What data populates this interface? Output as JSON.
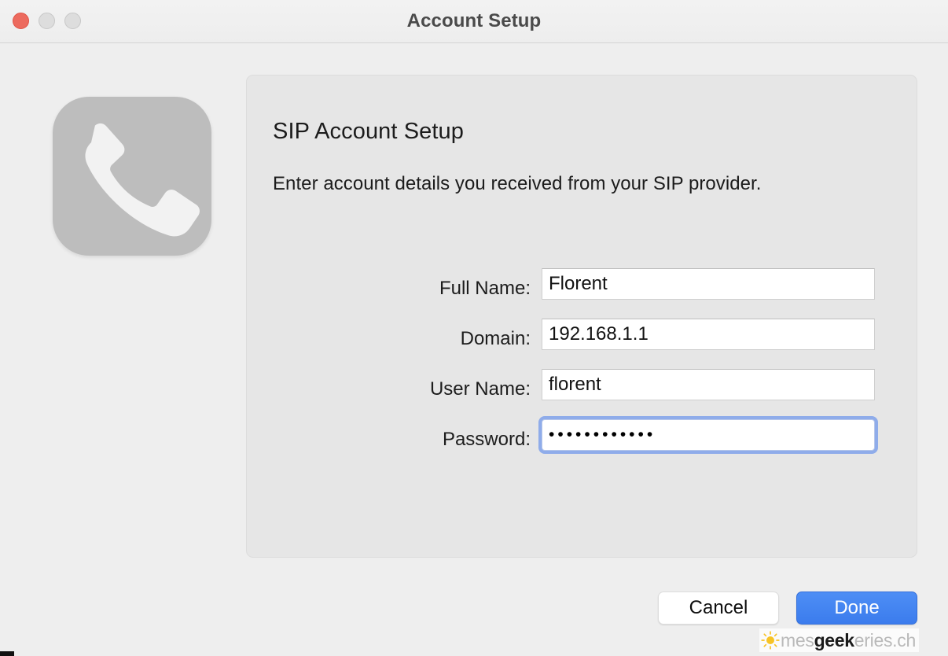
{
  "window": {
    "title": "Account Setup",
    "traffic_lights": [
      {
        "name": "close",
        "color": "#ec6a5e"
      },
      {
        "name": "minimize",
        "color": "#dddddd"
      },
      {
        "name": "zoom",
        "color": "#dddddd"
      }
    ]
  },
  "app_icon": {
    "name": "phone-handset-icon",
    "background_color": "#bdbdbd",
    "glyph_color": "#f2f2f2"
  },
  "panel": {
    "heading": "SIP Account Setup",
    "subtitle": "Enter account details you received from your SIP provider.",
    "background_color": "#e6e6e6"
  },
  "form": {
    "fields": [
      {
        "id": "full-name",
        "label": "Full Name:",
        "value": "Florent",
        "placeholder": "",
        "type": "text",
        "focused": false
      },
      {
        "id": "domain",
        "label": "Domain:",
        "value": "192.168.1.1",
        "placeholder": "",
        "type": "text",
        "focused": false
      },
      {
        "id": "user-name",
        "label": "User Name:",
        "value": "florent",
        "placeholder": "",
        "type": "text",
        "focused": false
      },
      {
        "id": "password",
        "label": "Password:",
        "value": "••••••••••••",
        "placeholder": "",
        "type": "password",
        "focused": true,
        "character_count": 12
      }
    ]
  },
  "footer": {
    "cancel_label": "Cancel",
    "done_label": "Done",
    "done_accent_color": "#3b7ced"
  },
  "watermark": {
    "icon": "sun-icon",
    "text_part_1": "mes",
    "text_part_2": "geek",
    "text_part_3": "eries.ch"
  }
}
